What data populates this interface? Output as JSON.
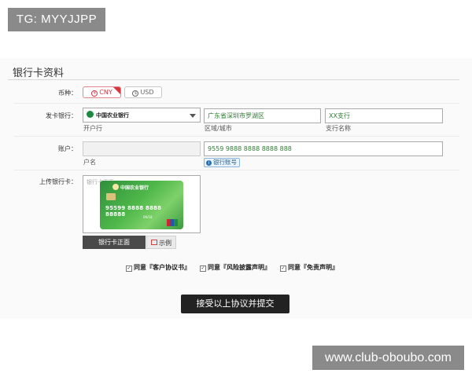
{
  "watermarks": {
    "top": "TG: MYYJJPP",
    "bottom": "www.club-oboubo.com"
  },
  "form": {
    "title": "银行卡资料",
    "currency": {
      "label": "币种：",
      "options": [
        "CNY",
        "USD"
      ],
      "selected": "CNY"
    },
    "issuer": {
      "label": "发卡银行：",
      "bank_value": "中国农业银行",
      "bank_hint": "开户行",
      "area_value": "广东省深圳市罗湖区",
      "area_hint": "区域/城市",
      "branch_value": "XX支行",
      "branch_hint": "支行名称"
    },
    "account": {
      "label": "账户：",
      "name_value": "",
      "name_hint": "户名",
      "number_value": "9559 9888 8888 8888 888",
      "number_tag": "银行账号"
    },
    "upload": {
      "label": "上传银行卡：",
      "placeholder": "银行卡正面",
      "card_bank": "中国农业银行",
      "card_number": "95599 8888 8888 88888",
      "card_date": "09/18",
      "front_button": "银行卡正面",
      "example_button": "示例"
    },
    "agreements": [
      {
        "text": "同意『客户协议书』",
        "checked": true
      },
      {
        "text": "同意『风险披露声明』",
        "checked": true
      },
      {
        "text": "同意『免责声明』",
        "checked": true
      }
    ],
    "submit": "接受以上协议并提交"
  },
  "colors": {
    "accent": "#d4373f",
    "valueGreen": "#2e7d32",
    "cardGreen": "#4fb84a"
  }
}
